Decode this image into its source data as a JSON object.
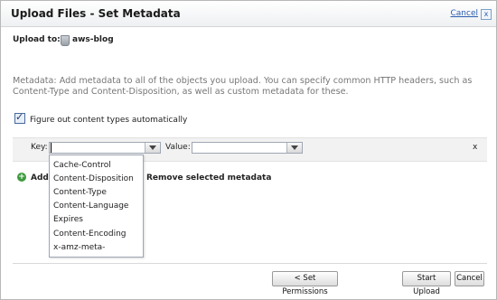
{
  "dialog": {
    "title": "Upload Files  -  Set Metadata",
    "cancel_link": "Cancel",
    "close_glyph": "x"
  },
  "upload_to": {
    "label": "Upload to:",
    "bucket": "aws-blog"
  },
  "metadata_description": "Metadata: Add metadata to all of the objects you upload. You can specify common HTTP headers, such as Content-Type and Content-Disposition, as well as custom metadata for these.",
  "auto_content_type": {
    "label": "Figure out content types automatically",
    "checked": true
  },
  "metadata_row": {
    "key_label": "Key:",
    "key_value": "",
    "value_label": "Value:",
    "value_value": "",
    "remove_glyph": "x"
  },
  "key_options": [
    "Cache-Control",
    "Content-Disposition",
    "Content-Type",
    "Content-Language",
    "Expires",
    "Content-Encoding",
    "x-amz-meta-"
  ],
  "actions": {
    "add_label": "Add",
    "add_icon_glyph": "+",
    "remove_selected_label": "Remove selected metadata"
  },
  "footer": {
    "set_permissions": "< Set Permissions",
    "start_upload": "Start Upload",
    "cancel": "Cancel"
  }
}
